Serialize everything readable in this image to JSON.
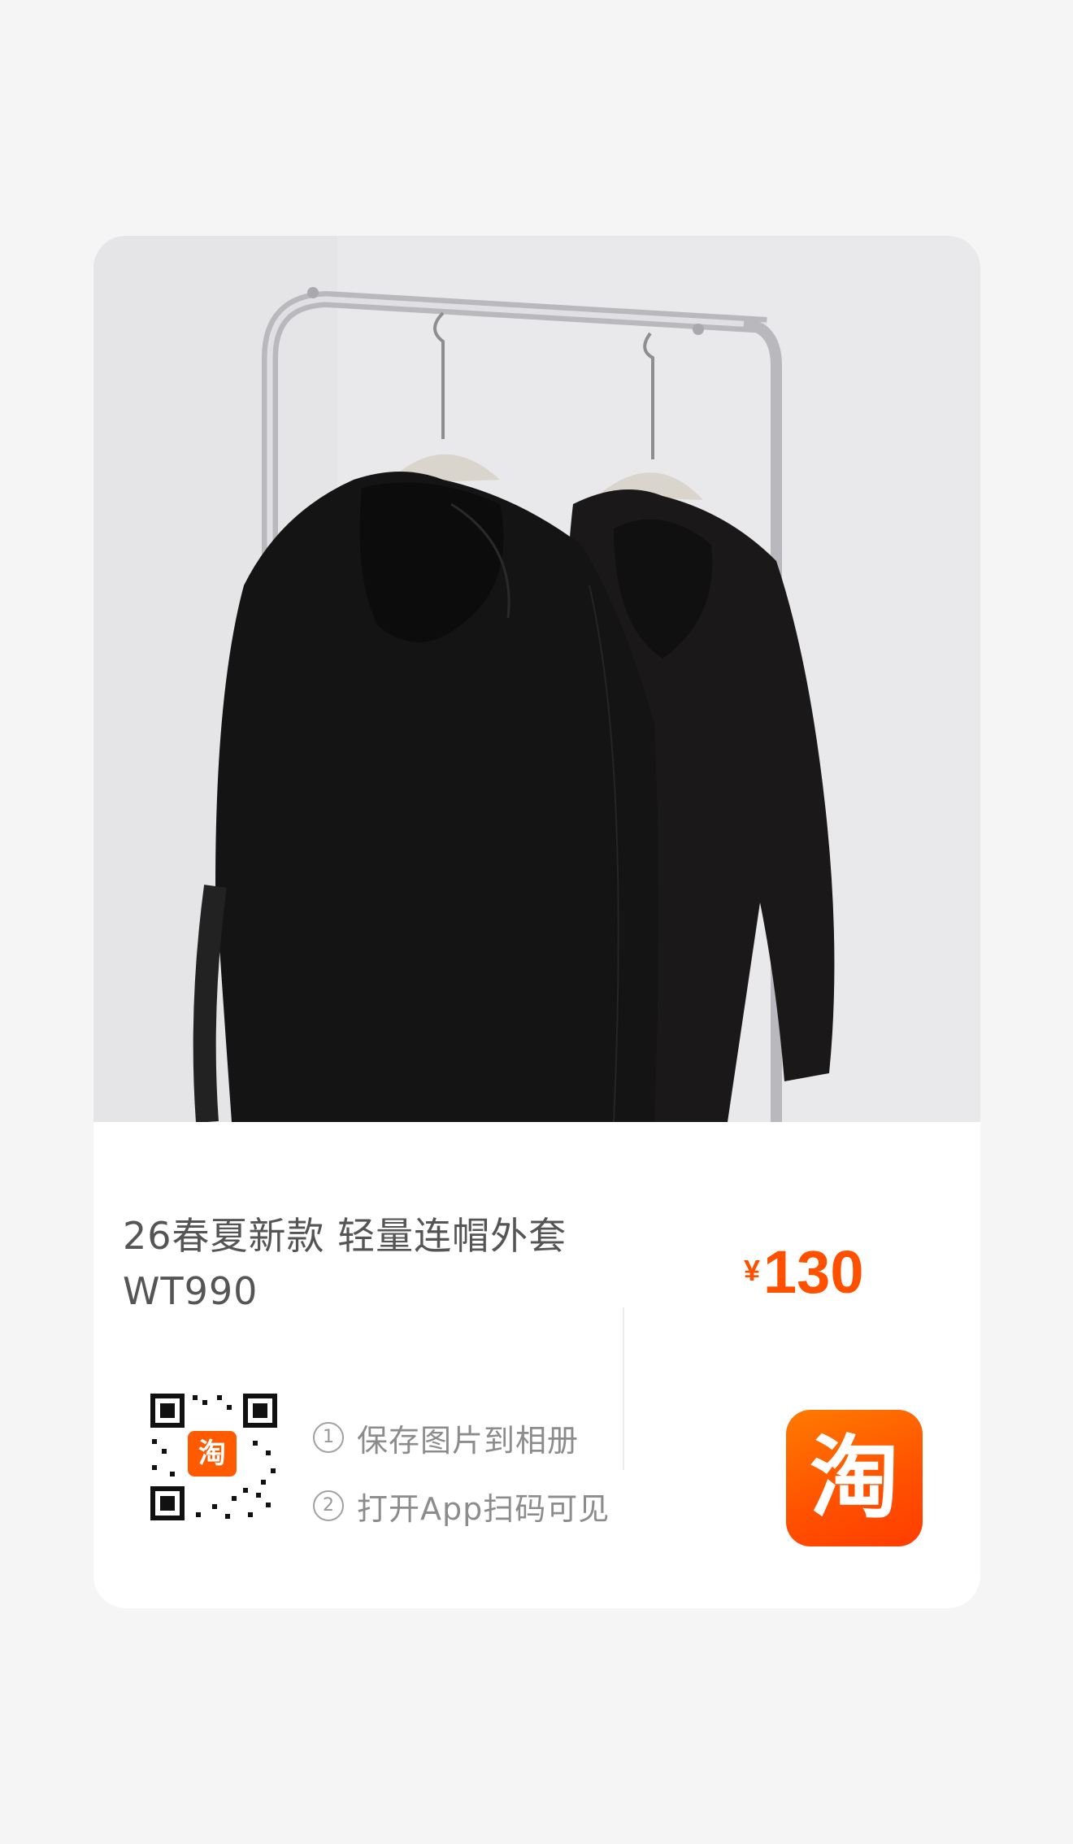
{
  "product": {
    "title": "26春夏新款 轻量连帽外套WT990",
    "currency_symbol": "¥",
    "price": "130"
  },
  "qr": {
    "badge": "淘"
  },
  "steps": [
    {
      "num": "1",
      "text": "保存图片到相册"
    },
    {
      "num": "2",
      "text": "打开App扫码可见"
    }
  ],
  "app_icon": {
    "glyph": "淘",
    "icon": "taobao-icon"
  },
  "colors": {
    "accent": "#ff5000",
    "page_bg": "#f5f5f5"
  }
}
